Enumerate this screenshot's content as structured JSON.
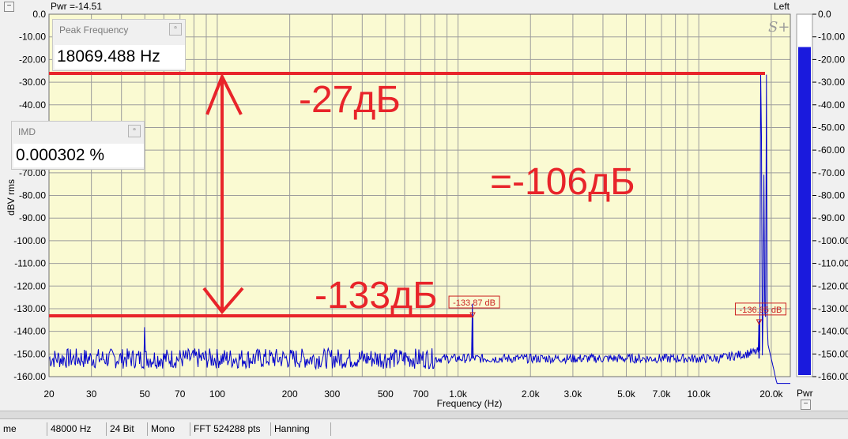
{
  "header": {
    "pwr_readout": "Pwr =-14.51",
    "channel": "Left",
    "collapse_symbol": "−",
    "logo_text": "S+"
  },
  "colors": {
    "plot_bg": "#fafad2",
    "grid": "#9c9c9c",
    "trace": "#0000cc",
    "annotation": "#e8242a",
    "marker": "#cc2222",
    "meter_fill": "#1a1add"
  },
  "panels": {
    "peak": {
      "title": "Peak Frequency",
      "value": "18069.488 Hz"
    },
    "imd": {
      "title": "IMD",
      "value": "0.000302 %"
    }
  },
  "annotations": {
    "top_level": "-27дБ",
    "bottom_level": "-133дБ",
    "difference": "=-106дБ"
  },
  "markers": [
    {
      "label": "-133.87 dB",
      "freq": 1150,
      "level": -133.87
    },
    {
      "label": "-136.95 dB",
      "freq": 17800,
      "level": -136.95
    }
  ],
  "meter": {
    "label": "Pwr",
    "value": -14.5,
    "min": -160,
    "max": 0,
    "ticks": [
      "0.0",
      "-10.00",
      "-20.00",
      "-30.00",
      "-40.00",
      "-50.00",
      "-60.00",
      "-70.00",
      "-80.00",
      "-90.00",
      "-100.00",
      "-110.00",
      "-120.00",
      "-130.00",
      "-140.00",
      "-150.00",
      "-160.00"
    ]
  },
  "status": {
    "items": [
      "me",
      "48000 Hz",
      "24 Bit",
      "Mono",
      "FFT 524288 pts",
      "Hanning"
    ]
  },
  "chart_data": {
    "type": "line",
    "xlabel": "Frequency (Hz)",
    "ylabel": "dBV rms",
    "xscale": "log",
    "xlim": [
      20,
      24000
    ],
    "ylim": [
      -160,
      0
    ],
    "grid": true,
    "x_ticks": [
      {
        "v": 20,
        "label": "20"
      },
      {
        "v": 30,
        "label": "30"
      },
      {
        "v": 50,
        "label": "50"
      },
      {
        "v": 70,
        "label": "70"
      },
      {
        "v": 100,
        "label": "100"
      },
      {
        "v": 200,
        "label": "200"
      },
      {
        "v": 300,
        "label": "300"
      },
      {
        "v": 500,
        "label": "500"
      },
      {
        "v": 700,
        "label": "700"
      },
      {
        "v": 1000,
        "label": "1.0k"
      },
      {
        "v": 2000,
        "label": "2.0k"
      },
      {
        "v": 3000,
        "label": "3.0k"
      },
      {
        "v": 5000,
        "label": "5.0k"
      },
      {
        "v": 7000,
        "label": "7.0k"
      },
      {
        "v": 10000,
        "label": "10.0k"
      },
      {
        "v": 20000,
        "label": "20.0k"
      }
    ],
    "y_ticks": [
      {
        "v": 0,
        "label": "0.0"
      },
      {
        "v": -10,
        "label": "-10.00"
      },
      {
        "v": -20,
        "label": "-20.00"
      },
      {
        "v": -30,
        "label": "-30.00"
      },
      {
        "v": -40,
        "label": "-40.00"
      },
      {
        "v": -50,
        "label": "-50.00"
      },
      {
        "v": -60,
        "label": "-60.00"
      },
      {
        "v": -70,
        "label": "-70.00"
      },
      {
        "v": -80,
        "label": "-80.00"
      },
      {
        "v": -90,
        "label": "-90.00"
      },
      {
        "v": -100,
        "label": "-100.00"
      },
      {
        "v": -110,
        "label": "-110.00"
      },
      {
        "v": -120,
        "label": "-120.00"
      },
      {
        "v": -130,
        "label": "-130.00"
      },
      {
        "v": -140,
        "label": "-140.00"
      },
      {
        "v": -150,
        "label": "-150.00"
      },
      {
        "v": -160,
        "label": "-160.00"
      }
    ],
    "noise_floor": -152,
    "peaks": [
      {
        "x": 50,
        "y": -144
      },
      {
        "x": 1150,
        "y": -133.9
      },
      {
        "x": 17800,
        "y": -137
      },
      {
        "x": 18069,
        "y": -27
      },
      {
        "x": 18250,
        "y": -60
      },
      {
        "x": 18600,
        "y": -80
      },
      {
        "x": 19100,
        "y": -27
      }
    ]
  }
}
